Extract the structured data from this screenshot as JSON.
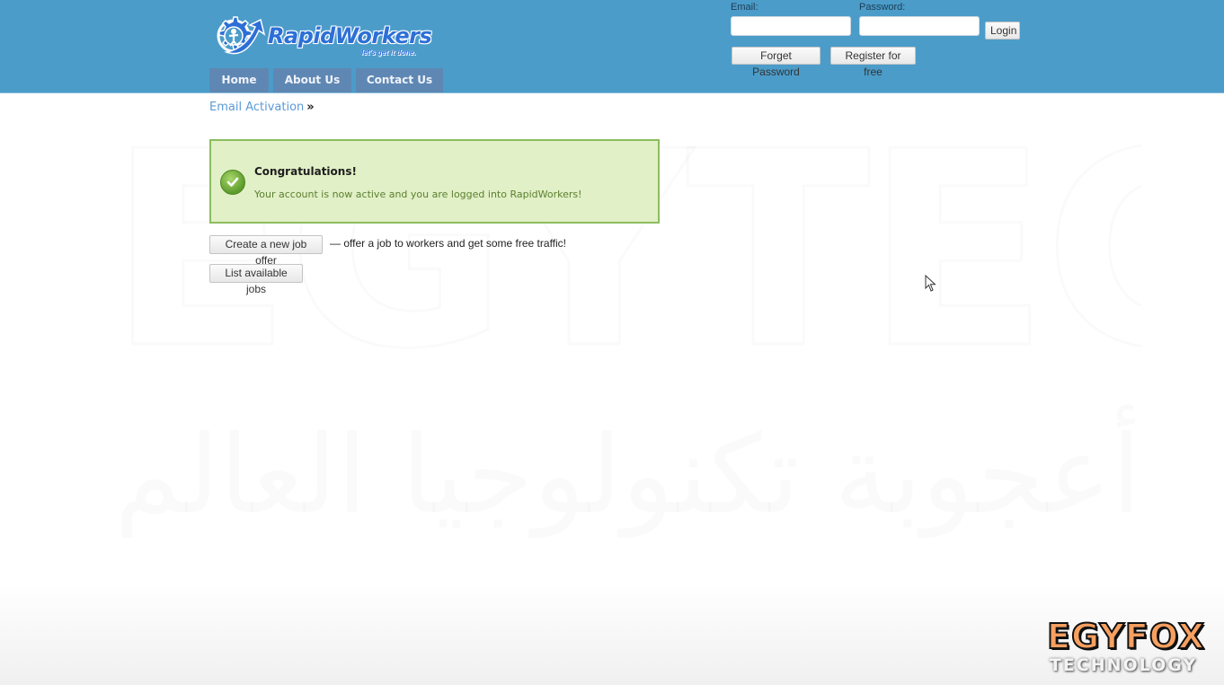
{
  "brand": {
    "name": "RapidWorkers",
    "tagline": "let's get it done."
  },
  "nav": {
    "items": [
      {
        "label": "Home"
      },
      {
        "label": "About Us"
      },
      {
        "label": "Contact Us"
      }
    ]
  },
  "login": {
    "email_label": "Email:",
    "email_value": "",
    "password_label": "Password:",
    "password_value": "",
    "login_button": "Login",
    "forgot_button": "Forget Password",
    "register_button": "Register for free"
  },
  "breadcrumb": {
    "current": "Email Activation",
    "separator": "»"
  },
  "notice": {
    "title": "Congratulations!",
    "message": "Your account is now active and you are logged into RapidWorkers!"
  },
  "actions": {
    "create_job_button": "Create a new job offer",
    "create_job_description": "—  offer a job to workers and get some free traffic!",
    "list_jobs_button": "List available jobs"
  },
  "watermark": {
    "large_text": "EGYTECH",
    "arabic_text": "أعجوبة تكنولوجيا العالم العربي"
  },
  "overlay_logo": {
    "top": "EGYFOX",
    "bottom": "TECHNOLOGY"
  },
  "colors": {
    "header_bg": "#4b9cc9",
    "nav_bg": "#5f87b3",
    "success_bg": "#e1f0c6",
    "success_border": "#8cbd60",
    "link": "#5c9ad6"
  }
}
